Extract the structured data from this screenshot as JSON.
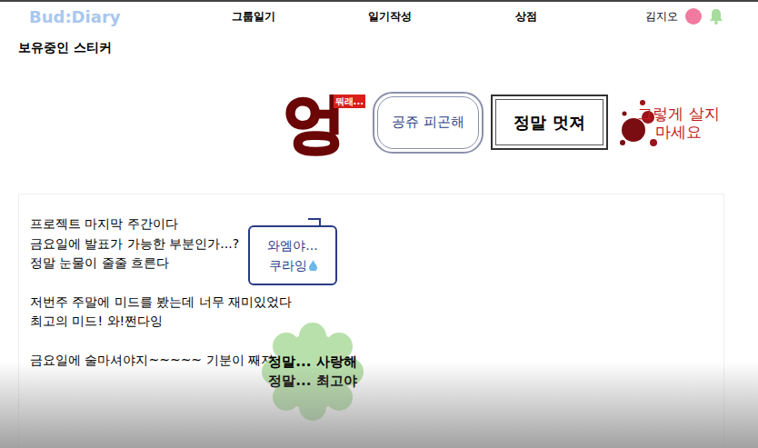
{
  "nav": {
    "logo": "Bud:Diary",
    "links": [
      {
        "label": "그룹일기",
        "selected": false
      },
      {
        "label": "일기작성",
        "selected": false
      },
      {
        "label": "상점",
        "selected": false
      }
    ],
    "user": "김지오"
  },
  "owned_stickers": {
    "title": "보유중인 스티커",
    "items": [
      {
        "kind": "shout",
        "lines": [
          "엉",
          "뭐래..."
        ]
      },
      {
        "kind": "ornate",
        "lines": [
          "공쥬 피곤해"
        ]
      },
      {
        "kind": "frame",
        "lines": [
          "정말 멋져"
        ]
      },
      {
        "kind": "splatter",
        "lines": [
          "그렇게 살지",
          "마세요"
        ]
      }
    ]
  },
  "diary": {
    "paragraphs": [
      [
        "프로젝트 마지막 주간이다",
        "금요일에 발표가 가능한 부분인가...?",
        "정말 눈물이 줄줄 흐른다"
      ],
      [
        "저번주 주말에 미드를 봤는데 너무 재미있었다",
        "최고의 미드! 와!쩐다잉"
      ],
      [
        "금요일에 술마셔야지~~~~~ 기분이 째져"
      ]
    ],
    "placed_stickers": [
      {
        "kind": "bubble",
        "lines": [
          "와엠야...",
          "쿠라잉"
        ]
      },
      {
        "kind": "cloud",
        "lines": [
          "정말... 사랑해",
          "정말... 최고야"
        ]
      }
    ]
  }
}
